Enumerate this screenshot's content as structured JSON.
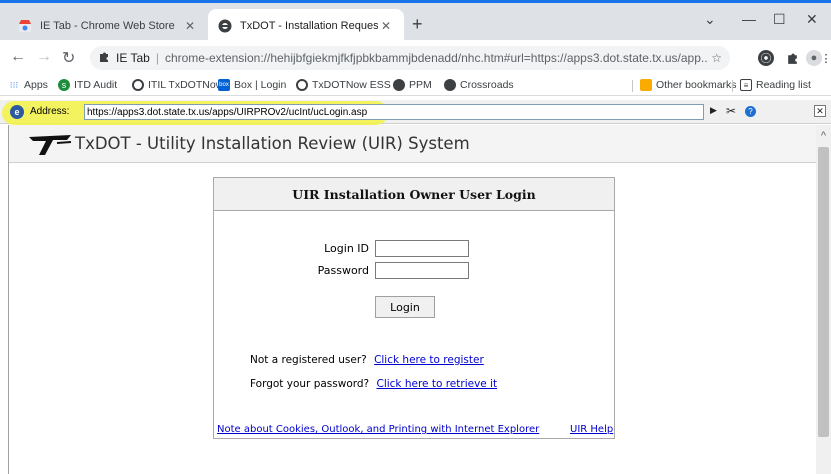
{
  "tabs": [
    {
      "title": "IE Tab - Chrome Web Store",
      "icon": "chrome-web-store-icon"
    },
    {
      "title": "TxDOT - Installation Request",
      "icon": "ie-tab-icon"
    }
  ],
  "toolbar": {
    "extension_chip": "IE Tab",
    "url": "chrome-extension://hehijbfgiekmjfkfjpbkbammjbdenadd/nhc.htm#url=https://apps3.dot.state.tx.us/app..."
  },
  "bookmarks": {
    "items": [
      "Apps",
      "ITD Audit",
      "ITIL TxDOTNow",
      "Box | Login",
      "TxDOTNow ESS",
      "PPM",
      "Crossroads"
    ],
    "other": "Other bookmarks",
    "reading_list": "Reading list"
  },
  "ie_address": {
    "label": "Address:",
    "value": "https://apps3.dot.state.tx.us/apps/UIRPROv2/ucInt/ucLogin.asp"
  },
  "page": {
    "title": "TxDOT - Utility Installation Review (UIR) System"
  },
  "login": {
    "heading": "UIR Installation Owner User Login",
    "login_id_label": "Login ID",
    "password_label": "Password",
    "login_button": "Login",
    "register_prompt": "Not a registered user?",
    "register_link": "Click here to register",
    "forgot_prompt": "Forgot your password?",
    "forgot_link": "Click here to retrieve it",
    "cookies_link": "Note about Cookies, Outlook, and Printing with Internet Explorer",
    "help_link": "UIR Help"
  },
  "colors": {
    "highlight": "#f3f347",
    "link": "#0000cc",
    "chrome_accent": "#1a73e8"
  }
}
